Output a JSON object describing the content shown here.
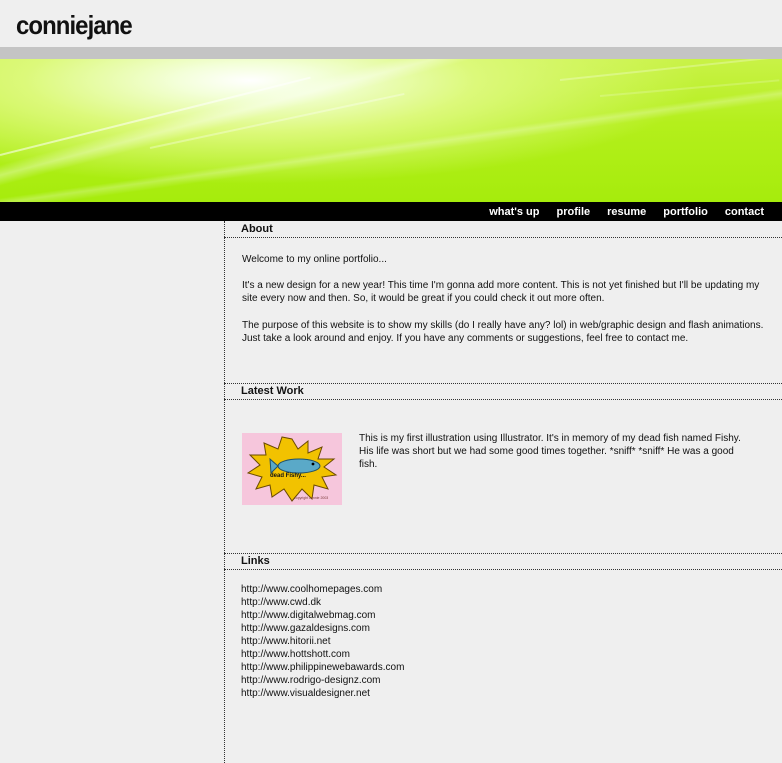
{
  "site": {
    "logo": "conniejane"
  },
  "nav": {
    "items": [
      {
        "label": "what's up"
      },
      {
        "label": "profile"
      },
      {
        "label": "resume"
      },
      {
        "label": "portfolio"
      },
      {
        "label": "contact"
      }
    ]
  },
  "about": {
    "title": "About",
    "paragraphs": [
      "Welcome to my online portfolio...",
      "It's a new design for a new year! This time I'm gonna add more content. This is not yet finished but I'll be updating my site every now and then. So, it would be great if you could check it out more often.",
      "The purpose of this website is to show my skills (do I really have any? lol) in web/graphic design and flash animations. Just take a look around and enjoy. If you have any comments or suggestions, feel free to contact me."
    ]
  },
  "latest_work": {
    "title": "Latest Work",
    "thumb_caption": "dead Fishy...",
    "thumb_copyright": "copyright connie 2003",
    "description": "This is my first illustration using Illustrator. It's in memory of my dead fish named Fishy. His life was short but we had some good times together. *sniff* *sniff* He was a good fish."
  },
  "links": {
    "title": "Links",
    "items": [
      "http://www.coolhomepages.com",
      "http://www.cwd.dk",
      "http://www.digitalwebmag.com",
      "http://www.gazaldesigns.com",
      "http://www.hitorii.net",
      "http://www.hottshott.com",
      "http://www.philippinewebawards.com",
      "http://www.rodrigo-designz.com",
      "http://www.visualdesigner.net"
    ]
  },
  "colors": {
    "page_background": "#efefef",
    "nav_background": "#000000",
    "banner_green": "#a6ec0c",
    "thumb_pink": "#f6c6dc",
    "fish_star_yellow": "#f2c200"
  }
}
